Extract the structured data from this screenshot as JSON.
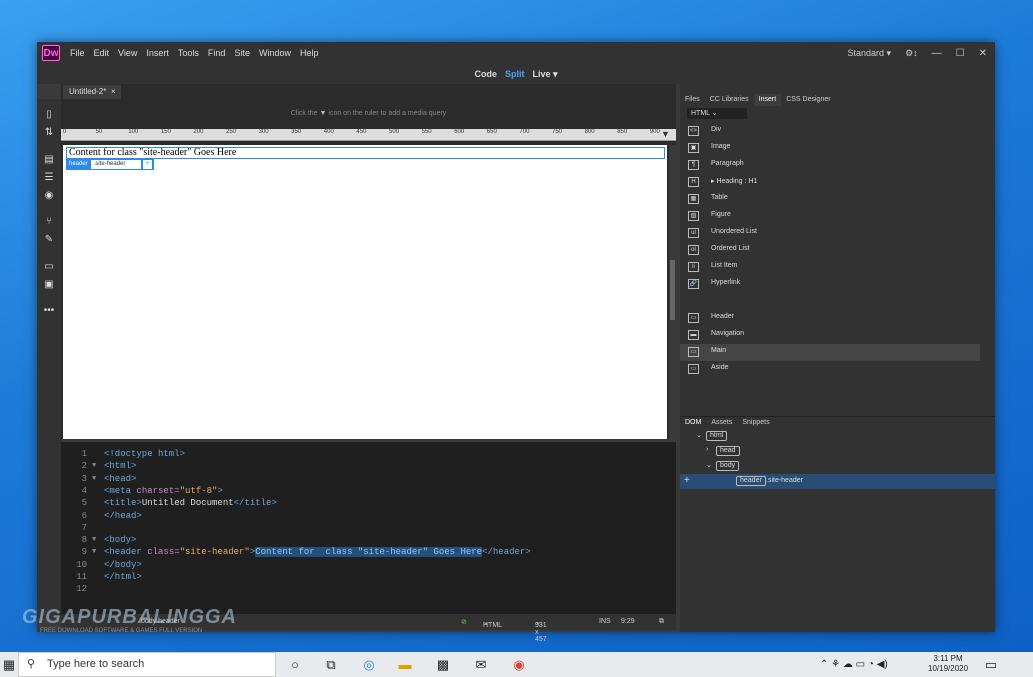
{
  "app": {
    "logo": "Dw",
    "menu": [
      "File",
      "Edit",
      "View",
      "Insert",
      "Tools",
      "Find",
      "Site",
      "Window",
      "Help"
    ],
    "workspace": "Standard",
    "workspace_caret": "▾",
    "views": {
      "code": "Code",
      "split": "Split",
      "live": "Live",
      "caret": "▾"
    }
  },
  "document_tab": {
    "name": "Untitled-2*",
    "close": "×"
  },
  "design": {
    "media_query_hint_before": "Click the",
    "media_query_hint_after": "icon on the ruler to add a media query",
    "ruler_ticks": [
      "0",
      "50",
      "100",
      "150",
      "200",
      "250",
      "300",
      "350",
      "400",
      "450",
      "500",
      "550",
      "600",
      "650",
      "700",
      "750",
      "800",
      "850",
      "900"
    ],
    "header_content": "Content for class \"site-header\" Goes Here",
    "badge_tag": "header",
    "badge_class": ".site-header",
    "badge_plus": "+"
  },
  "code": {
    "lines": [
      {
        "n": "1",
        "fold": "",
        "html": "<span class=\"tag\">&lt;!doctype html&gt;</span>"
      },
      {
        "n": "2",
        "fold": "▼",
        "html": "<span class=\"tag\">&lt;html&gt;</span>"
      },
      {
        "n": "3",
        "fold": "▼",
        "html": "<span class=\"tag\">&lt;head&gt;</span>"
      },
      {
        "n": "4",
        "fold": "",
        "html": "<span class=\"tag\">&lt;meta</span> <span class=\"att\">charset=</span><span class=\"val\">\"utf-8\"</span><span class=\"tag\">&gt;</span>"
      },
      {
        "n": "5",
        "fold": "",
        "html": "<span class=\"tag\">&lt;title&gt;</span>Untitled Document<span class=\"tag\">&lt;/title&gt;</span>"
      },
      {
        "n": "6",
        "fold": "",
        "html": "<span class=\"tag\">&lt;/head&gt;</span>"
      },
      {
        "n": "7",
        "fold": "",
        "html": ""
      },
      {
        "n": "8",
        "fold": "▼",
        "html": "<span class=\"tag\">&lt;body&gt;</span>"
      },
      {
        "n": "9",
        "fold": "▼",
        "html": "<span class=\"tag\">&lt;header</span> <span class=\"att\">class=</span><span class=\"val\">\"site-header\"</span><span class=\"tag\">&gt;</span><span class=\"sel\">Content for  class \"site-header\" Goes Here</span><span class=\"tag\">&lt;/header&gt;</span>"
      },
      {
        "n": "10",
        "fold": "",
        "html": "<span class=\"tag\">&lt;/body&gt;</span>"
      },
      {
        "n": "11",
        "fold": "",
        "html": "<span class=\"tag\">&lt;/html&gt;</span>"
      },
      {
        "n": "12",
        "fold": "",
        "html": ""
      }
    ]
  },
  "status": {
    "crumb": "body header",
    "lang": "HTML",
    "size": "931 x 457",
    "mode": "INS",
    "pos": "9:29"
  },
  "panels": {
    "tabs": [
      "Files",
      "CC Libraries",
      "Insert",
      "CSS Designer"
    ],
    "active_tab": "Insert",
    "insert_category": "HTML",
    "insert_items": [
      {
        "icon": "<>",
        "label": "Div"
      },
      {
        "icon": "▣",
        "label": "Image"
      },
      {
        "icon": "¶",
        "label": "Paragraph"
      },
      {
        "icon": "H",
        "label": "Heading : H1",
        "caret": "▸"
      },
      {
        "icon": "▦",
        "label": "Table"
      },
      {
        "icon": "▨",
        "label": "Figure"
      },
      {
        "icon": "ul",
        "label": "Unordered List"
      },
      {
        "icon": "ol",
        "label": "Ordered List"
      },
      {
        "icon": "li",
        "label": "List Item"
      },
      {
        "icon": "🔗",
        "label": "Hyperlink"
      },
      {
        "icon": "▭",
        "label": "Header"
      },
      {
        "icon": "▬",
        "label": "Navigation"
      },
      {
        "icon": "▭",
        "label": "Main"
      },
      {
        "icon": "▭",
        "label": "Aside"
      }
    ],
    "dom_tabs": [
      "DOM",
      "Assets",
      "Snippets"
    ],
    "dom_tree": [
      {
        "tag": "html",
        "caret": "⌄",
        "indent": 16
      },
      {
        "tag": "head",
        "caret": "›",
        "indent": 26
      },
      {
        "tag": "body",
        "caret": "⌄",
        "indent": 26
      },
      {
        "tag": "header",
        "cls": ".site-header",
        "caret": "",
        "indent": 46,
        "selected": true,
        "plus": "+"
      }
    ]
  },
  "taskbar": {
    "search_placeholder": "Type here to search",
    "time": "3:11 PM",
    "date": "10/19/2020"
  },
  "watermark": {
    "text": "GIGAPURBALINGGA",
    "sub": "FREE DOWNLOAD SOFTWARE & GAMES FULL VERSION"
  }
}
